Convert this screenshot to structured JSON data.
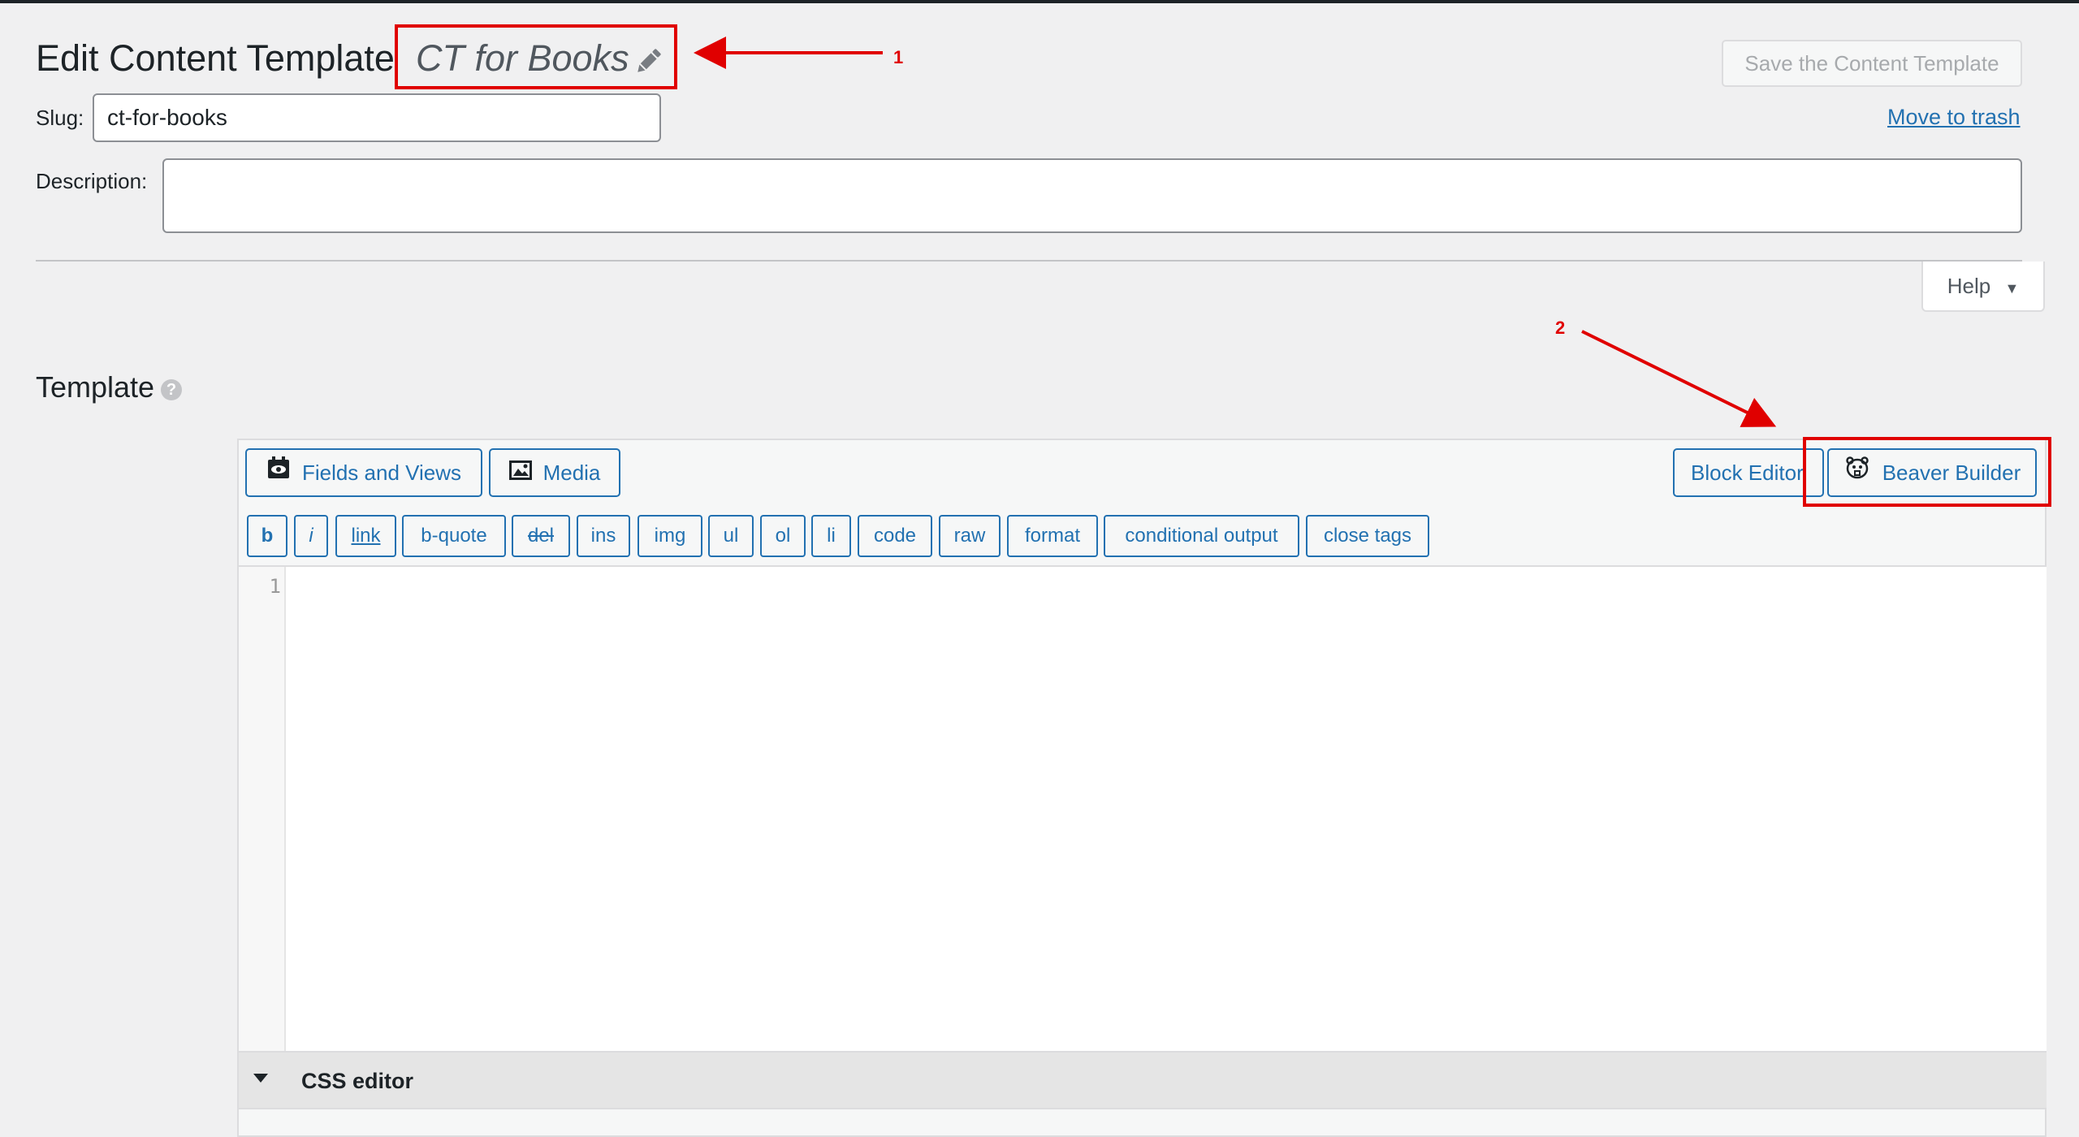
{
  "header": {
    "title": "Edit Content Template",
    "template_name": "CT for Books",
    "save_label": "Save the Content Template",
    "trash_label": "Move to trash"
  },
  "form": {
    "slug_label": "Slug:",
    "slug_value": "ct-for-books",
    "description_label": "Description:",
    "description_value": ""
  },
  "help_label": "Help",
  "template_section": {
    "title": "Template",
    "help_icon": "question-icon"
  },
  "editor": {
    "top_buttons": {
      "fields_views": "Fields and Views",
      "media": "Media",
      "block_editor": "Block Editor",
      "beaver_builder": "Beaver Builder"
    },
    "quicktags": [
      "b",
      "i",
      "link",
      "b-quote",
      "del",
      "ins",
      "img",
      "ul",
      "ol",
      "li",
      "code",
      "raw",
      "format",
      "conditional output",
      "close tags"
    ],
    "line_number": "1",
    "css_editor_label": "CSS editor"
  },
  "annotations": {
    "one": "1",
    "two": "2",
    "color": "#e00000"
  },
  "colors": {
    "link_blue": "#2271b1",
    "background": "#f0f0f1"
  },
  "icons": [
    "pencil-icon",
    "fields-views-icon",
    "media-icon",
    "beaver-builder-icon",
    "caret-down-icon",
    "question-icon"
  ]
}
